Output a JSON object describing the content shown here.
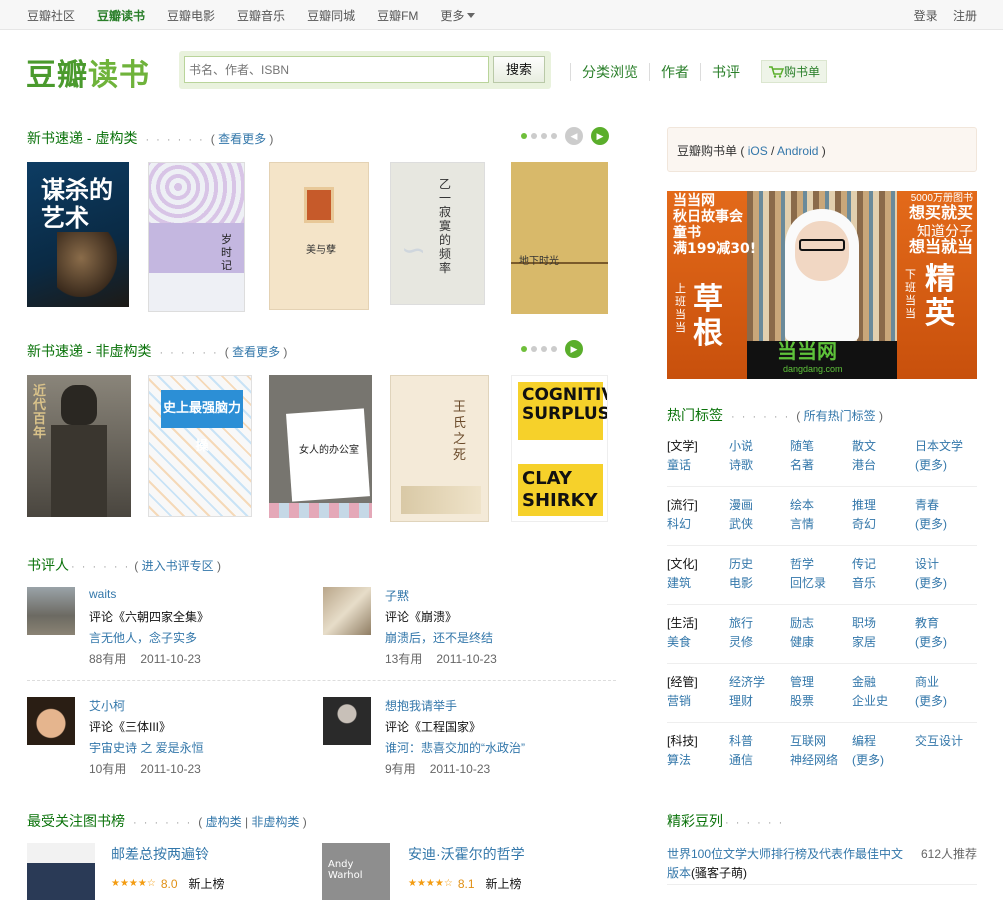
{
  "topnav": {
    "items": [
      "豆瓣社区",
      "豆瓣读书",
      "豆瓣电影",
      "豆瓣音乐",
      "豆瓣同城",
      "豆瓣FM",
      "更多"
    ],
    "login": "登录",
    "register": "注册"
  },
  "logo": {
    "part1": "豆瓣",
    "part2": "读书"
  },
  "search": {
    "placeholder": "书名、作者、ISBN",
    "button": "搜索"
  },
  "mainnav": {
    "browse": "分类浏览",
    "author": "作者",
    "review": "书评",
    "cart": "购书单"
  },
  "fiction": {
    "title": "新书速递 - 虚构类",
    "dots": "· · · · · ·",
    "more": "查看更多",
    "books": [
      {
        "cover_text": "谋杀的艺术"
      },
      {
        "cover_text": "岁时记"
      },
      {
        "cover_text": "美与孽"
      },
      {
        "cover_text": "乙一 寂寞的频率"
      },
      {
        "cover_text": "地下时光"
      }
    ]
  },
  "nonfiction": {
    "title": "新书速递 - 非虚构类",
    "dots": "· · · · · ·",
    "more": "查看更多",
    "books": [
      {
        "cover_text": "近代百年"
      },
      {
        "cover_text": "史上最强脑力操"
      },
      {
        "cover_text": "女人的办公室"
      },
      {
        "cover_text": "王氏之死"
      },
      {
        "cover_line1": "COGNITIVE",
        "cover_line2": "SURPLUS",
        "cover_line3": "CLAY",
        "cover_line4": "SHIRKY"
      }
    ]
  },
  "reviewers": {
    "title": "书评人",
    "dots": "· · · · · ·",
    "link": "进入书评专区",
    "items": [
      {
        "name": "waits",
        "title": "评论《六朝四家全集》",
        "quote": "言无他人，念子实多",
        "useful": "88有用",
        "date": "2011-10-23"
      },
      {
        "name": "子黙",
        "title": "评论《崩溃》",
        "quote": "崩溃后，还不是终结",
        "useful": "13有用",
        "date": "2011-10-23"
      },
      {
        "name": "艾小柯",
        "title": "评论《三体III》",
        "quote": "宇宙史诗 之 爱是永恒",
        "useful": "10有用",
        "date": "2011-10-23"
      },
      {
        "name": "想抱我请举手",
        "title": "评论《工程国家》",
        "quote": "谁河：悲喜交加的“水政治”",
        "useful": "9有用",
        "date": "2011-10-23"
      }
    ]
  },
  "charts": {
    "title": "最受关注图书榜",
    "dots": "· · · · · ·",
    "link1": "虚构类",
    "link2": "非虚构类",
    "items": [
      {
        "title": "邮差总按两遍铃",
        "stars": "★★★★☆",
        "rating": "8.0",
        "badge": "新上榜"
      },
      {
        "title": "安迪·沃霍尔的哲学",
        "stars": "★★★★☆",
        "rating": "8.1",
        "badge": "新上榜",
        "cover_text": "Andy Warhol"
      }
    ]
  },
  "app": {
    "text": "豆瓣购书单",
    "ios": "iOS",
    "android": "Android"
  },
  "ad": {
    "top_line1": "当当网",
    "top_line2": "秋日故事会",
    "top_line3": "童书",
    "top_line4": "满199减30!",
    "right_line1": "5000万册图书",
    "right_line2": "想买就买",
    "right_line3": "知道分子",
    "right_line4": "想当就当",
    "left_big": "草根",
    "left_small": "上班当当",
    "right_big": "精英",
    "right_small": "下班当当",
    "brand": "当当网",
    "domain": "dangdang.com"
  },
  "tags": {
    "title": "热门标签",
    "dots": "· · · · · ·",
    "all": "所有热门标签",
    "groups": [
      {
        "cat": "[文学]",
        "row1": [
          "小说",
          "随笔",
          "散文",
          "日本文学"
        ],
        "row2": [
          "童话",
          "诗歌",
          "名著",
          "港台",
          "(更多)"
        ]
      },
      {
        "cat": "[流行]",
        "row1": [
          "漫画",
          "绘本",
          "推理",
          "青春"
        ],
        "row2": [
          "科幻",
          "武侠",
          "言情",
          "奇幻",
          "(更多)"
        ]
      },
      {
        "cat": "[文化]",
        "row1": [
          "历史",
          "哲学",
          "传记",
          "设计"
        ],
        "row2": [
          "建筑",
          "电影",
          "回忆录",
          "音乐",
          "(更多)"
        ]
      },
      {
        "cat": "[生活]",
        "row1": [
          "旅行",
          "励志",
          "职场",
          "教育"
        ],
        "row2": [
          "美食",
          "灵修",
          "健康",
          "家居",
          "(更多)"
        ]
      },
      {
        "cat": "[经管]",
        "row1": [
          "经济学",
          "管理",
          "金融",
          "商业"
        ],
        "row2": [
          "营销",
          "理财",
          "股票",
          "企业史",
          "(更多)"
        ]
      },
      {
        "cat": "[科技]",
        "row1": [
          "科普",
          "互联网",
          "编程",
          "交互设计"
        ],
        "row2": [
          "算法",
          "通信",
          "神经网络",
          "(更多)"
        ]
      }
    ]
  },
  "doulist": {
    "title": "精彩豆列",
    "dots": "· · · · · ·",
    "item_title": "世界100位文学大师排行榜及代表作最佳中文版本",
    "item_author": "(骚客子萌)",
    "item_count": "612人推荐"
  }
}
